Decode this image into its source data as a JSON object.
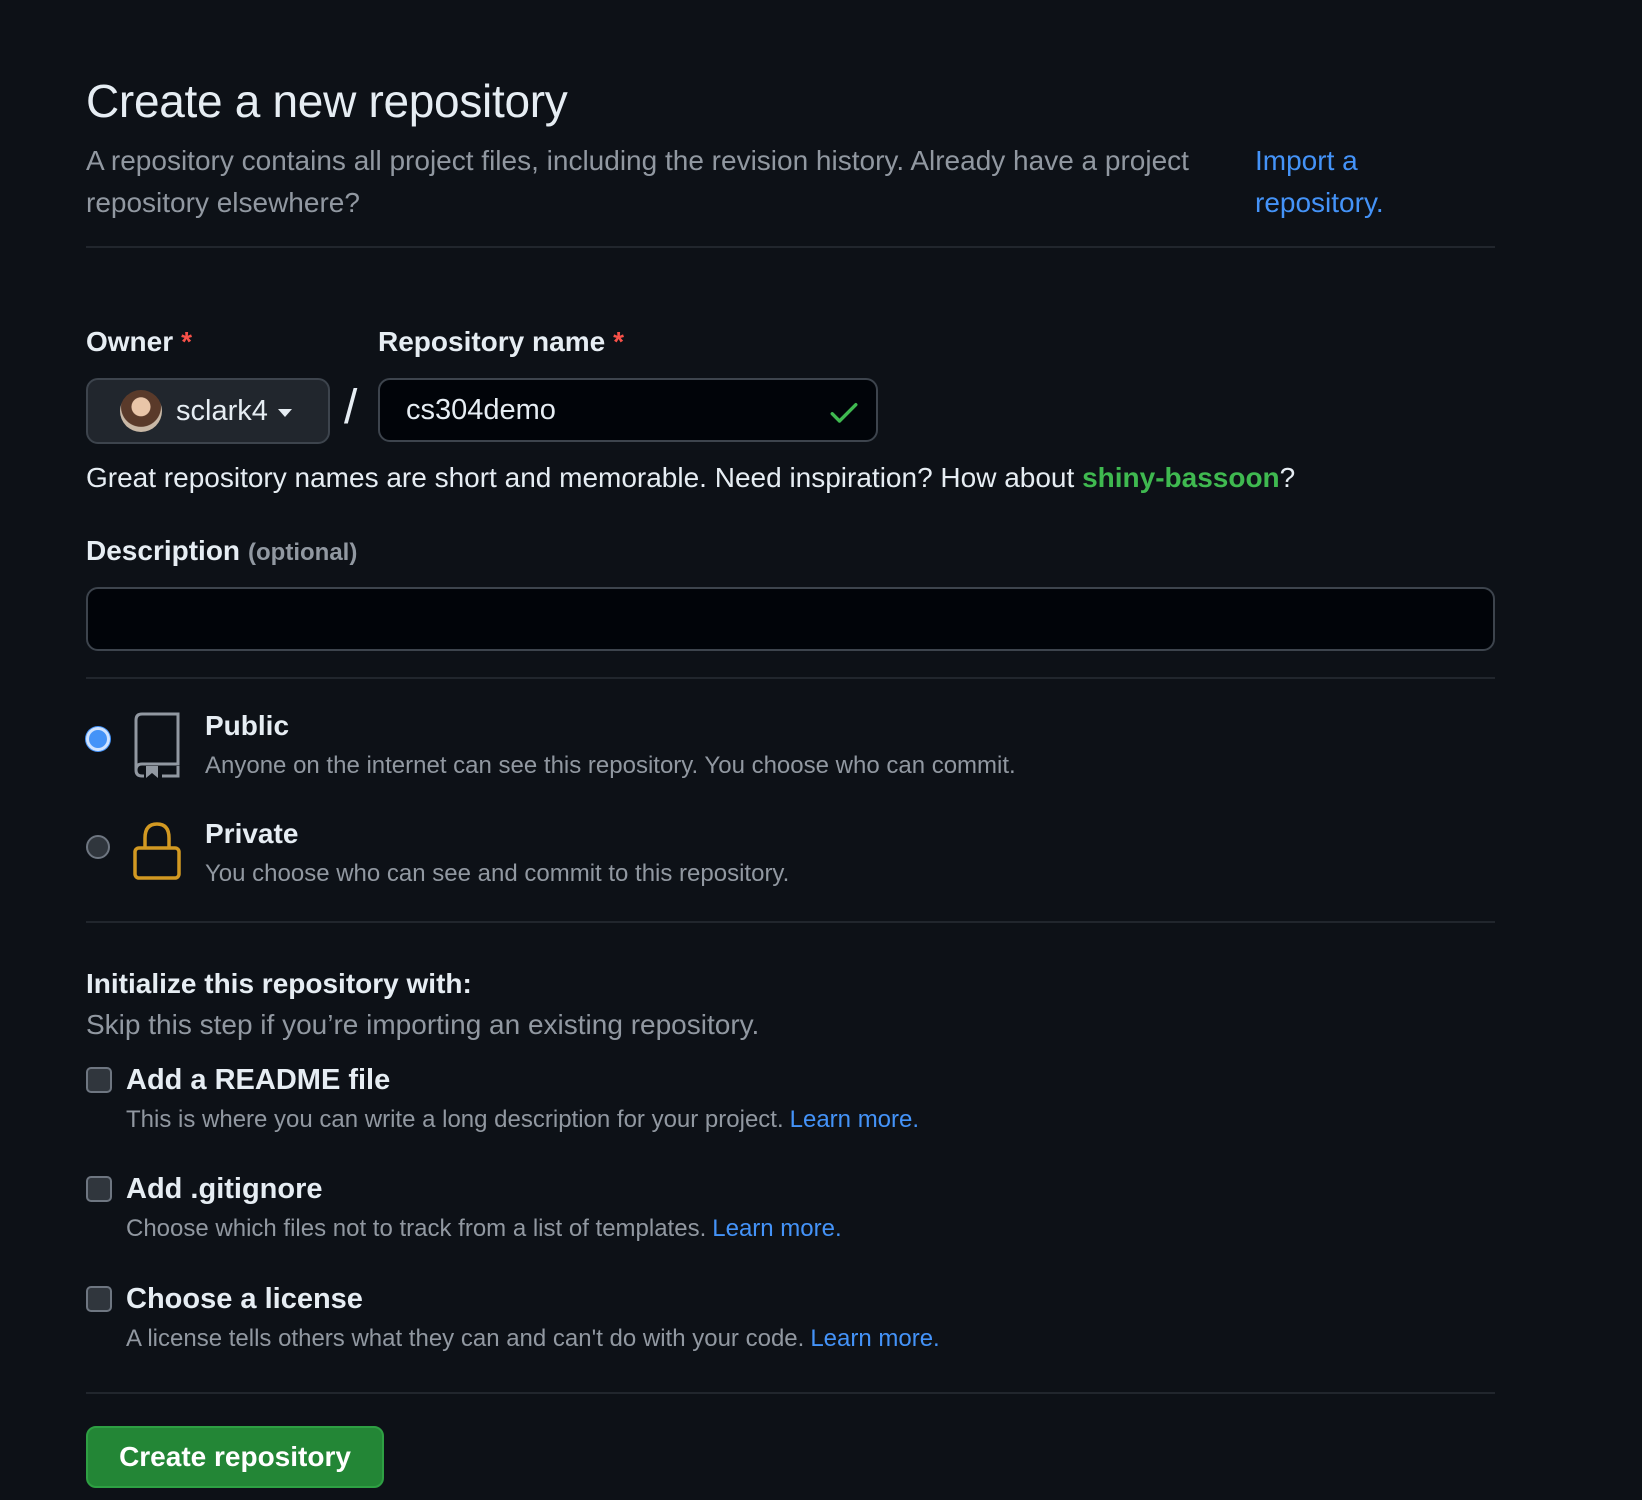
{
  "header": {
    "title": "Create a new repository",
    "subtitle": "A repository contains all project files, including the revision history. Already have a project repository elsewhere?",
    "import_link": "Import a repository."
  },
  "owner": {
    "label": "Owner",
    "required_mark": "*",
    "value": "sclark4"
  },
  "separator": "/",
  "repo_name": {
    "label": "Repository name",
    "required_mark": "*",
    "value": "cs304demo"
  },
  "hint": {
    "text": "Great repository names are short and memorable. Need inspiration? How about ",
    "suggestion": "shiny-bassoon",
    "suffix": "?"
  },
  "description": {
    "label": "Description",
    "optional": "(optional)",
    "value": ""
  },
  "visibility": {
    "public": {
      "title": "Public",
      "desc": "Anyone on the internet can see this repository. You choose who can commit.",
      "selected": true,
      "icon": "repo-icon"
    },
    "private": {
      "title": "Private",
      "desc": "You choose who can see and commit to this repository.",
      "selected": false,
      "icon": "lock-icon"
    }
  },
  "initialize": {
    "title": "Initialize this repository with:",
    "subtitle": "Skip this step if you’re importing an existing repository.",
    "options": [
      {
        "title": "Add a README file",
        "desc": "This is where you can write a long description for your project.",
        "link": "Learn more.",
        "checked": false
      },
      {
        "title": "Add .gitignore",
        "desc": "Choose which files not to track from a list of templates.",
        "link": "Learn more.",
        "checked": false
      },
      {
        "title": "Choose a license",
        "desc": "A license tells others what they can and can't do with your code.",
        "link": "Learn more.",
        "checked": false
      }
    ]
  },
  "submit": {
    "label": "Create repository"
  },
  "colors": {
    "background": "#0d1117",
    "link": "#4493f8",
    "success": "#3fb950",
    "button": "#238636",
    "required": "#f85149",
    "lock": "#d29922"
  }
}
